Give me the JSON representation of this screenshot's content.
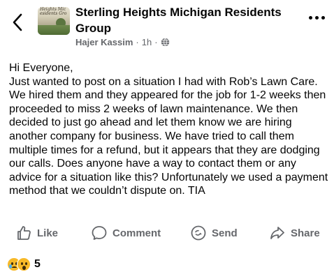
{
  "header": {
    "back_icon": "chevron-left-icon",
    "group_name": "Sterling Heights Michigan Residents Group",
    "thumbnail_text_line1": "Heights Mic",
    "thumbnail_text_line2": "esidents Gro",
    "author": "Hajer Kassim",
    "separator": "·",
    "time": "1h",
    "privacy_icon": "globe-icon",
    "more_icon": "more-horizontal-icon"
  },
  "post": {
    "text": "Hi Everyone,\nJust wanted to post on a situation I had with Rob’s Lawn Care. We hired them and they appeared for the job for 1-2 weeks then proceeded to miss 2 weeks of lawn maintenance. We then decided to just go ahead and let them know we are hiring another company for business. We have tried to call them multiple times for a refund, but it appears that they are dodging our calls. Does anyone have a way to contact them or any advice for a situation like this? Unfortunately we used a payment method that we couldn’t dispute on. TIA"
  },
  "actions": {
    "like": "Like",
    "comment": "Comment",
    "send": "Send",
    "share": "Share"
  },
  "reactions": {
    "types": [
      "sad",
      "wow"
    ],
    "count": "5"
  }
}
